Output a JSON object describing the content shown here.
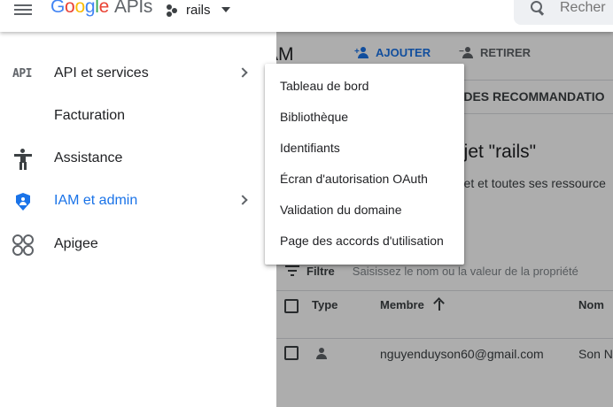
{
  "header": {
    "logo": {
      "g": "G",
      "o1": "o",
      "o2": "o",
      "g2": "g",
      "l": "l",
      "e": "e",
      "apis": "APIs"
    },
    "project_name": "rails",
    "search_placeholder": "Recher"
  },
  "sidebar": {
    "items": [
      {
        "label": "API et services",
        "icon": "api-icon",
        "has_submenu": true
      },
      {
        "label": "Facturation",
        "icon": "billing-icon",
        "has_submenu": false
      },
      {
        "label": "Assistance",
        "icon": "accessibility-icon",
        "has_submenu": false
      },
      {
        "label": "IAM et admin",
        "icon": "shield-icon",
        "has_submenu": true,
        "active": true
      },
      {
        "label": "Apigee",
        "icon": "apigee-icon",
        "has_submenu": false
      }
    ],
    "active_color": "#1a73e8"
  },
  "submenu": {
    "items": [
      "Tableau de bord",
      "Bibliothèque",
      "Identifiants",
      "Écran d'autorisation OAuth",
      "Validation du domaine",
      "Page des accords d'utilisation"
    ]
  },
  "main": {
    "page_title_fragment": "AM",
    "add_label": "AJOUTER",
    "remove_label": "RETIRER",
    "tab_fragment": "UE DES RECOMMANDATIO",
    "perm_title_fragment": "rojet \"rails\"",
    "perm_subtitle_fragment": "rojet et toutes ses ressource",
    "filter": {
      "label": "Filtre",
      "placeholder": "Saisissez le nom ou la valeur de la propriété"
    },
    "table": {
      "headers": [
        "Type",
        "Membre",
        "Nom"
      ],
      "rows": [
        {
          "type_icon": "person-icon",
          "member": "nguyenduyson60@gmail.com",
          "name": "Son N"
        }
      ]
    }
  },
  "colors": {
    "accent": "#1a73e8",
    "text": "#202124",
    "icon": "#5f6368"
  }
}
